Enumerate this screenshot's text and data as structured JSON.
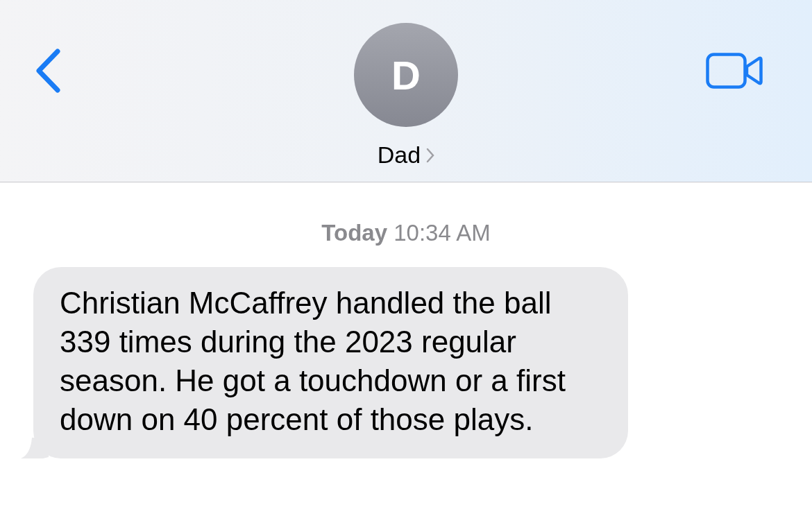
{
  "header": {
    "avatar_initial": "D",
    "contact_name": "Dad"
  },
  "timestamp": {
    "day": "Today",
    "time": "10:34 AM"
  },
  "messages": [
    {
      "outgoing": false,
      "text": "Christian McCaffrey handled the ball 339 times during the 2023 regular season. He got a touchdown or a first down on 40 percent of those plays."
    }
  ]
}
